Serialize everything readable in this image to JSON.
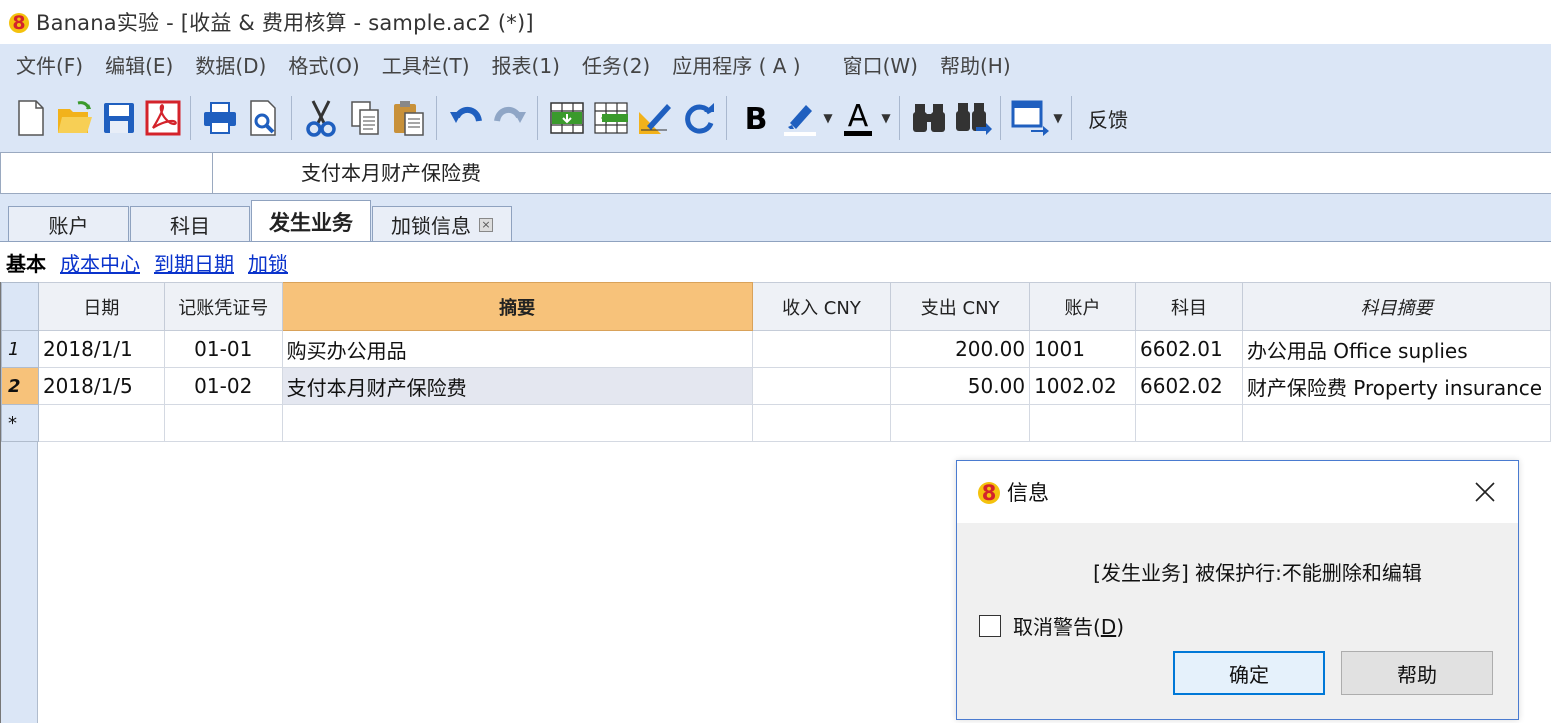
{
  "window": {
    "title": "Banana实验 - [收益 & 费用核算 - sample.ac2 (*)]"
  },
  "menu": {
    "items": [
      "文件(F)",
      "编辑(E)",
      "数据(D)",
      "格式(O)",
      "工具栏(T)",
      "报表(1)",
      "任务(2)",
      "应用程序 ( A )",
      "窗口(W)",
      "帮助(H)"
    ]
  },
  "toolbar": {
    "feedback_label": "反馈",
    "icons": [
      "new-file-icon",
      "open-folder-icon",
      "save-icon",
      "pdf-icon",
      "print-icon",
      "print-preview-icon",
      "cut-icon",
      "copy-icon",
      "paste-icon",
      "undo-icon",
      "redo-icon",
      "insert-row-icon",
      "delete-row-icon",
      "edit-icon",
      "recalculate-icon",
      "bold-icon",
      "highlight-icon",
      "font-color-icon",
      "find-icon",
      "find-next-icon",
      "window-icon"
    ],
    "colors": {
      "bar_bg": "#dbe6f6",
      "pdf_red": "#d4232b",
      "folder_yellow": "#f2b21b",
      "undo_blue": "#1f5fbf"
    }
  },
  "formula_bar": {
    "cell_content": "支付本月财产保险费"
  },
  "tabs": [
    {
      "label": "账户",
      "active": false
    },
    {
      "label": "科目",
      "active": false
    },
    {
      "label": "发生业务",
      "active": true
    },
    {
      "label": "加锁信息",
      "active": false,
      "closable": true
    }
  ],
  "views": {
    "current": "基本",
    "links": [
      "成本中心",
      "到期日期",
      "加锁"
    ]
  },
  "table": {
    "columns": [
      "日期",
      "记账凭证号",
      "摘要",
      "收入 CNY",
      "支出 CNY",
      "账户",
      "科目",
      "科目摘要"
    ],
    "rows": [
      {
        "num": "1",
        "date": "2018/1/1",
        "doc": "01-01",
        "desc": "购买办公用品",
        "income": "",
        "expense": "200.00",
        "account": "1001",
        "category": "6602.01",
        "category_desc": "办公用品 Office suplies"
      },
      {
        "num": "2",
        "date": "2018/1/5",
        "doc": "01-02",
        "desc": "支付本月财产保险费",
        "income": "",
        "expense": "50.00",
        "account": "1002.02",
        "category": "6602.02",
        "category_desc": "财产保险费 Property insurance"
      }
    ],
    "new_row_marker": "*"
  },
  "dialog": {
    "title": "信息",
    "message": "[发生业务] 被保护行:不能删除和编辑",
    "checkbox_label": "取消警告(",
    "checkbox_accel": "D",
    "checkbox_label_end": ")",
    "ok_label": "确定",
    "help_label": "帮助"
  }
}
